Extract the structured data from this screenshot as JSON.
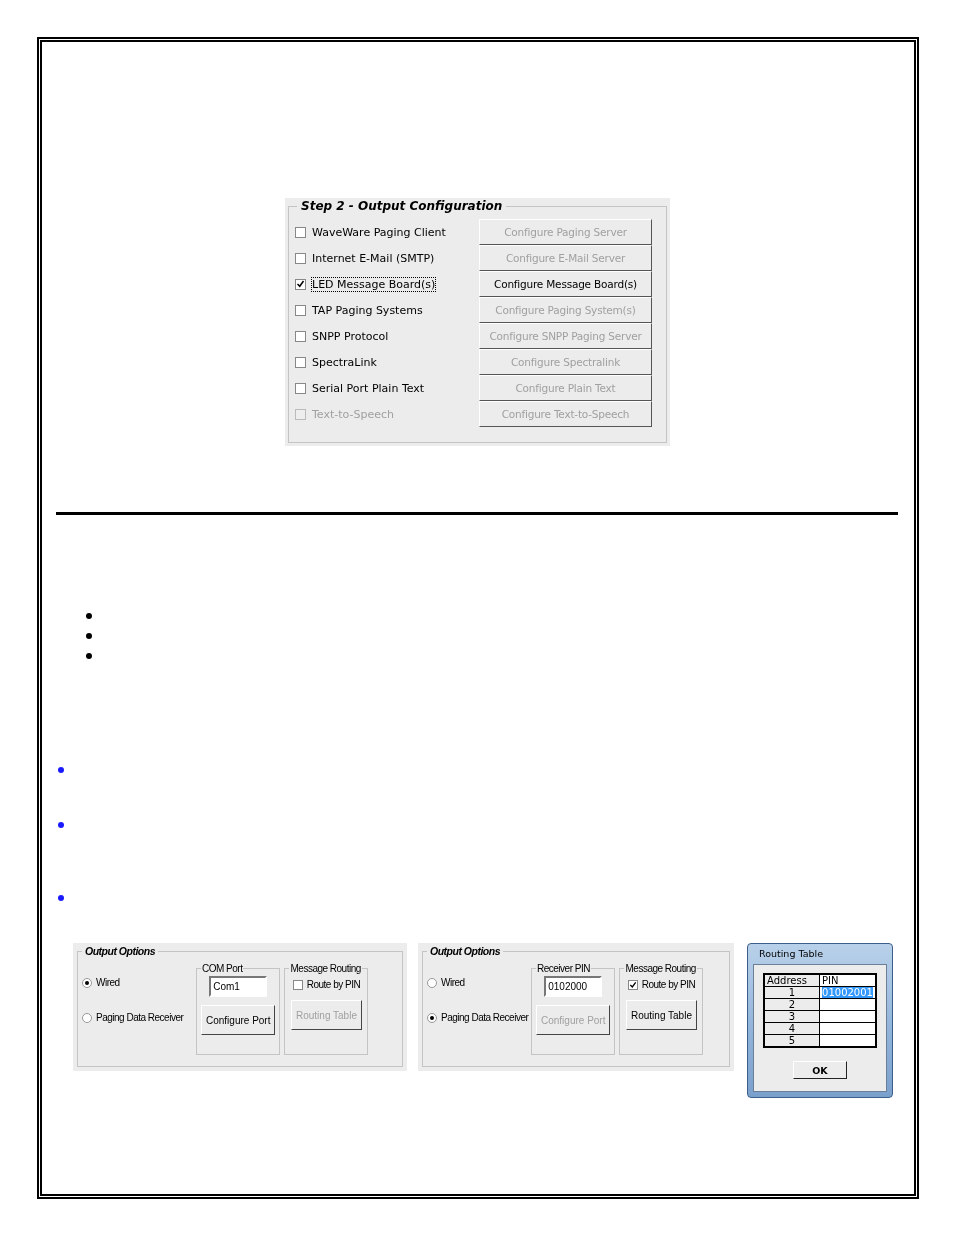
{
  "step2": {
    "title": "Step 2 - Output Configuration",
    "rows": [
      {
        "label": "WaveWare Paging Client",
        "checked": false,
        "disabled": false,
        "focused": false,
        "button": {
          "label": "Configure Paging Server",
          "disabled": true
        }
      },
      {
        "label": "Internet E-Mail (SMTP)",
        "checked": false,
        "disabled": false,
        "focused": false,
        "button": {
          "label": "Configure E-Mail Server",
          "disabled": true
        }
      },
      {
        "label": "LED Message Board(s)",
        "checked": true,
        "disabled": false,
        "focused": true,
        "button": {
          "label": "Configure Message Board(s)",
          "disabled": false
        }
      },
      {
        "label": "TAP Paging Systems",
        "checked": false,
        "disabled": false,
        "focused": false,
        "button": {
          "label": "Configure Paging System(s)",
          "disabled": true
        }
      },
      {
        "label": "SNPP Protocol",
        "checked": false,
        "disabled": false,
        "focused": false,
        "button": {
          "label": "Configure SNPP Paging Server",
          "disabled": true
        }
      },
      {
        "label": "SpectraLink",
        "checked": false,
        "disabled": false,
        "focused": false,
        "button": {
          "label": "Configure Spectralink",
          "disabled": true
        }
      },
      {
        "label": "Serial Port Plain Text",
        "checked": false,
        "disabled": false,
        "focused": false,
        "button": {
          "label": "Configure Plain Text",
          "disabled": true
        }
      },
      {
        "label": "Text-to-Speech",
        "checked": false,
        "disabled": true,
        "focused": false,
        "button": {
          "label": "Configure Text-to-Speech",
          "disabled": true
        }
      }
    ]
  },
  "bullet_lists": [
    {
      "kind": "indented",
      "items": [
        {
          "color": "#000000"
        },
        {
          "color": "#000000"
        },
        {
          "color": "#000000"
        }
      ]
    },
    {
      "kind": "flush",
      "items": [
        {
          "color": "#1a1aff"
        },
        {
          "color": "#1a1aff"
        },
        {
          "color": "#1a1aff"
        }
      ]
    }
  ],
  "output_panels": [
    {
      "title": "Output Options",
      "radios": [
        {
          "label": "Wired",
          "selected": true
        },
        {
          "label": "Paging Data Receiver",
          "selected": false
        }
      ],
      "group": {
        "title": "COM Port",
        "value": "Com1",
        "button": {
          "label": "Configure Port",
          "disabled": false
        }
      },
      "routing": {
        "title": "Message Routing",
        "checkbox": {
          "label": "Route by PIN",
          "checked": false
        },
        "button": {
          "label": "Routing Table",
          "disabled": true
        }
      }
    },
    {
      "title": "Output Options",
      "radios": [
        {
          "label": "Wired",
          "selected": false
        },
        {
          "label": "Paging Data Receiver",
          "selected": true
        }
      ],
      "group": {
        "title": "Receiver PIN",
        "value": "0102000",
        "button": {
          "label": "Configure Port",
          "disabled": true
        }
      },
      "routing": {
        "title": "Message Routing",
        "checkbox": {
          "label": "Route by PIN",
          "checked": true
        },
        "button": {
          "label": "Routing Table",
          "disabled": false
        }
      }
    }
  ],
  "routing_dialog": {
    "title": "Routing Table",
    "columns": [
      "Address",
      "PIN"
    ],
    "rows": [
      {
        "address": "1",
        "pin": "01002001",
        "selected": true
      },
      {
        "address": "2",
        "selected": false
      },
      {
        "address": "3",
        "selected": false
      },
      {
        "address": "4",
        "selected": false
      },
      {
        "address": "5",
        "selected": false
      }
    ],
    "ok_button": "OK"
  }
}
